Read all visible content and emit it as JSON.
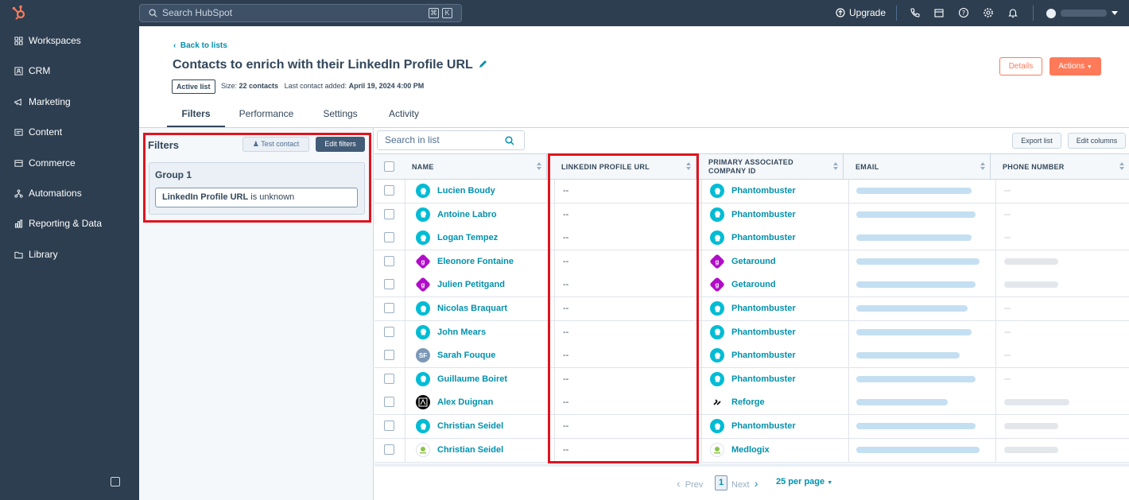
{
  "topbar": {
    "search_placeholder": "Search HubSpot",
    "shortcut_keys": [
      "⌘",
      "K"
    ],
    "upgrade_label": "Upgrade"
  },
  "sidebar": {
    "items": [
      {
        "label": "Workspaces",
        "icon": "grid-icon"
      },
      {
        "label": "CRM",
        "icon": "contacts-icon"
      },
      {
        "label": "Marketing",
        "icon": "megaphone-icon"
      },
      {
        "label": "Content",
        "icon": "content-icon"
      },
      {
        "label": "Commerce",
        "icon": "commerce-icon"
      },
      {
        "label": "Automations",
        "icon": "automation-icon"
      },
      {
        "label": "Reporting & Data",
        "icon": "chart-icon"
      },
      {
        "label": "Library",
        "icon": "folder-icon"
      }
    ]
  },
  "header": {
    "back_label": "Back to lists",
    "title": "Contacts to enrich with their LinkedIn Profile URL",
    "status_badge": "Active list",
    "size_label": "Size:",
    "size_value": "22 contacts",
    "last_added_label": "Last contact added:",
    "last_added_value": "April 19, 2024 4:00 PM",
    "details_label": "Details",
    "actions_label": "Actions"
  },
  "tabs": [
    {
      "label": "Filters",
      "active": true
    },
    {
      "label": "Performance",
      "active": false
    },
    {
      "label": "Settings",
      "active": false
    },
    {
      "label": "Activity",
      "active": false
    }
  ],
  "filters": {
    "title": "Filters",
    "test_contact_label": "Test contact",
    "edit_filters_label": "Edit filters",
    "group_title": "Group 1",
    "condition_property": "LinkedIn Profile URL",
    "condition_operator": "is unknown"
  },
  "table": {
    "search_placeholder": "Search in list",
    "export_label": "Export list",
    "edit_columns_label": "Edit columns",
    "columns": [
      "NAME",
      "LINKEDIN PROFILE URL",
      "PRIMARY ASSOCIATED COMPANY ID",
      "EMAIL",
      "PHONE NUMBER"
    ],
    "rows": [
      {
        "name": "Lucien Boudy",
        "avatar": "pb",
        "linkedin": "--",
        "company": "Phantombuster",
        "company_logo": "pb",
        "has_phone": false
      },
      {
        "name": "Antoine Labro",
        "avatar": "pb",
        "linkedin": "--",
        "company": "Phantombuster",
        "company_logo": "pb",
        "has_phone": false
      },
      {
        "name": "Logan Tempez",
        "avatar": "pb",
        "linkedin": "--",
        "company": "Phantombuster",
        "company_logo": "pb",
        "has_phone": false
      },
      {
        "name": "Eleonore Fontaine",
        "avatar": "ga",
        "linkedin": "--",
        "company": "Getaround",
        "company_logo": "ga",
        "has_phone": true
      },
      {
        "name": "Julien Petitgand",
        "avatar": "ga",
        "linkedin": "--",
        "company": "Getaround",
        "company_logo": "ga",
        "has_phone": true
      },
      {
        "name": "Nicolas Braquart",
        "avatar": "pb",
        "linkedin": "--",
        "company": "Phantombuster",
        "company_logo": "pb",
        "has_phone": false
      },
      {
        "name": "John Mears",
        "avatar": "pb",
        "linkedin": "--",
        "company": "Phantombuster",
        "company_logo": "pb",
        "has_phone": false
      },
      {
        "name": "Sarah Fouque",
        "avatar": "sf",
        "avatar_text": "SF",
        "linkedin": "--",
        "company": "Phantombuster",
        "company_logo": "pb",
        "has_phone": false
      },
      {
        "name": "Guillaume Boiret",
        "avatar": "pb",
        "linkedin": "--",
        "company": "Phantombuster",
        "company_logo": "pb",
        "has_phone": false
      },
      {
        "name": "Alex Duignan",
        "avatar": "ad",
        "linkedin": "--",
        "company": "Reforge",
        "company_logo": "rf",
        "has_phone": true
      },
      {
        "name": "Christian Seidel",
        "avatar": "pb",
        "linkedin": "--",
        "company": "Phantombuster",
        "company_logo": "pb",
        "has_phone": true
      },
      {
        "name": "Christian Seidel",
        "avatar": "med",
        "linkedin": "--",
        "company": "Medlogix",
        "company_logo": "med",
        "has_phone": true
      }
    ]
  },
  "pager": {
    "prev_label": "Prev",
    "current_page": "1",
    "next_label": "Next",
    "per_page_label": "25 per page"
  },
  "colors": {
    "accent": "#ff7a59",
    "link": "#0091ae",
    "nav_bg": "#2d3e50",
    "highlight_box": "#e0141e"
  }
}
